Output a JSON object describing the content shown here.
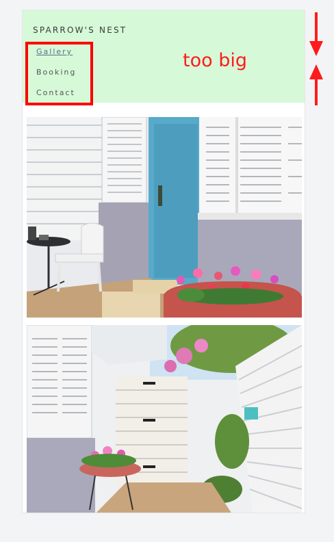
{
  "site": {
    "brand": "SPARROW'S NEST",
    "nav": [
      {
        "label": "Gallery"
      },
      {
        "label": "Booking"
      },
      {
        "label": "Contact"
      }
    ]
  },
  "annotation": {
    "text": "too big",
    "color": "#ff0000"
  },
  "colors": {
    "header_bg": "#d6f9d8",
    "page_bg": "#f3f4f5"
  },
  "icons": [
    "arrow-down-icon",
    "arrow-up-icon"
  ]
}
